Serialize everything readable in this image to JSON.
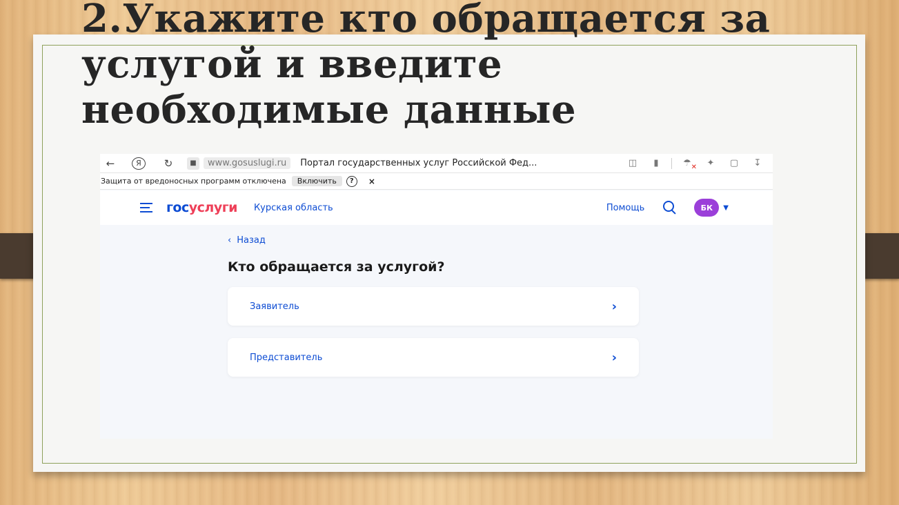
{
  "slide": {
    "title_line1": "2.Укажите кто обращается за",
    "title_line2": "услугой и введите",
    "title_line3": "необходимые данные"
  },
  "browser": {
    "back_icon": "←",
    "yandex_icon": "Я",
    "reload_icon": "↻",
    "lock_icon": "🔒",
    "url": "www.gosuslugi.ru",
    "tab_title": "Портал государственных услуг Российской Фед...",
    "toolbar_icons": [
      "translate-icon",
      "bookmark-icon",
      "protect-icon",
      "feather-icon",
      "shirt-icon",
      "download-icon"
    ]
  },
  "warning": {
    "text": "Защита от вредоносных программ отключена",
    "enable_label": "Включить",
    "help_label": "?",
    "close_label": "×"
  },
  "header": {
    "logo_part1": "гос",
    "logo_part2": "услуги",
    "region": "Курская область",
    "help": "Помощь",
    "avatar_initials": "БК"
  },
  "main": {
    "back_label": "Назад",
    "question": "Кто обращается за услугой?",
    "options": [
      {
        "label": "Заявитель"
      },
      {
        "label": "Представитель"
      }
    ]
  },
  "colors": {
    "accent": "#0d4cd3",
    "logo_red": "#ee3f58",
    "avatar": "#9b3fd9"
  }
}
